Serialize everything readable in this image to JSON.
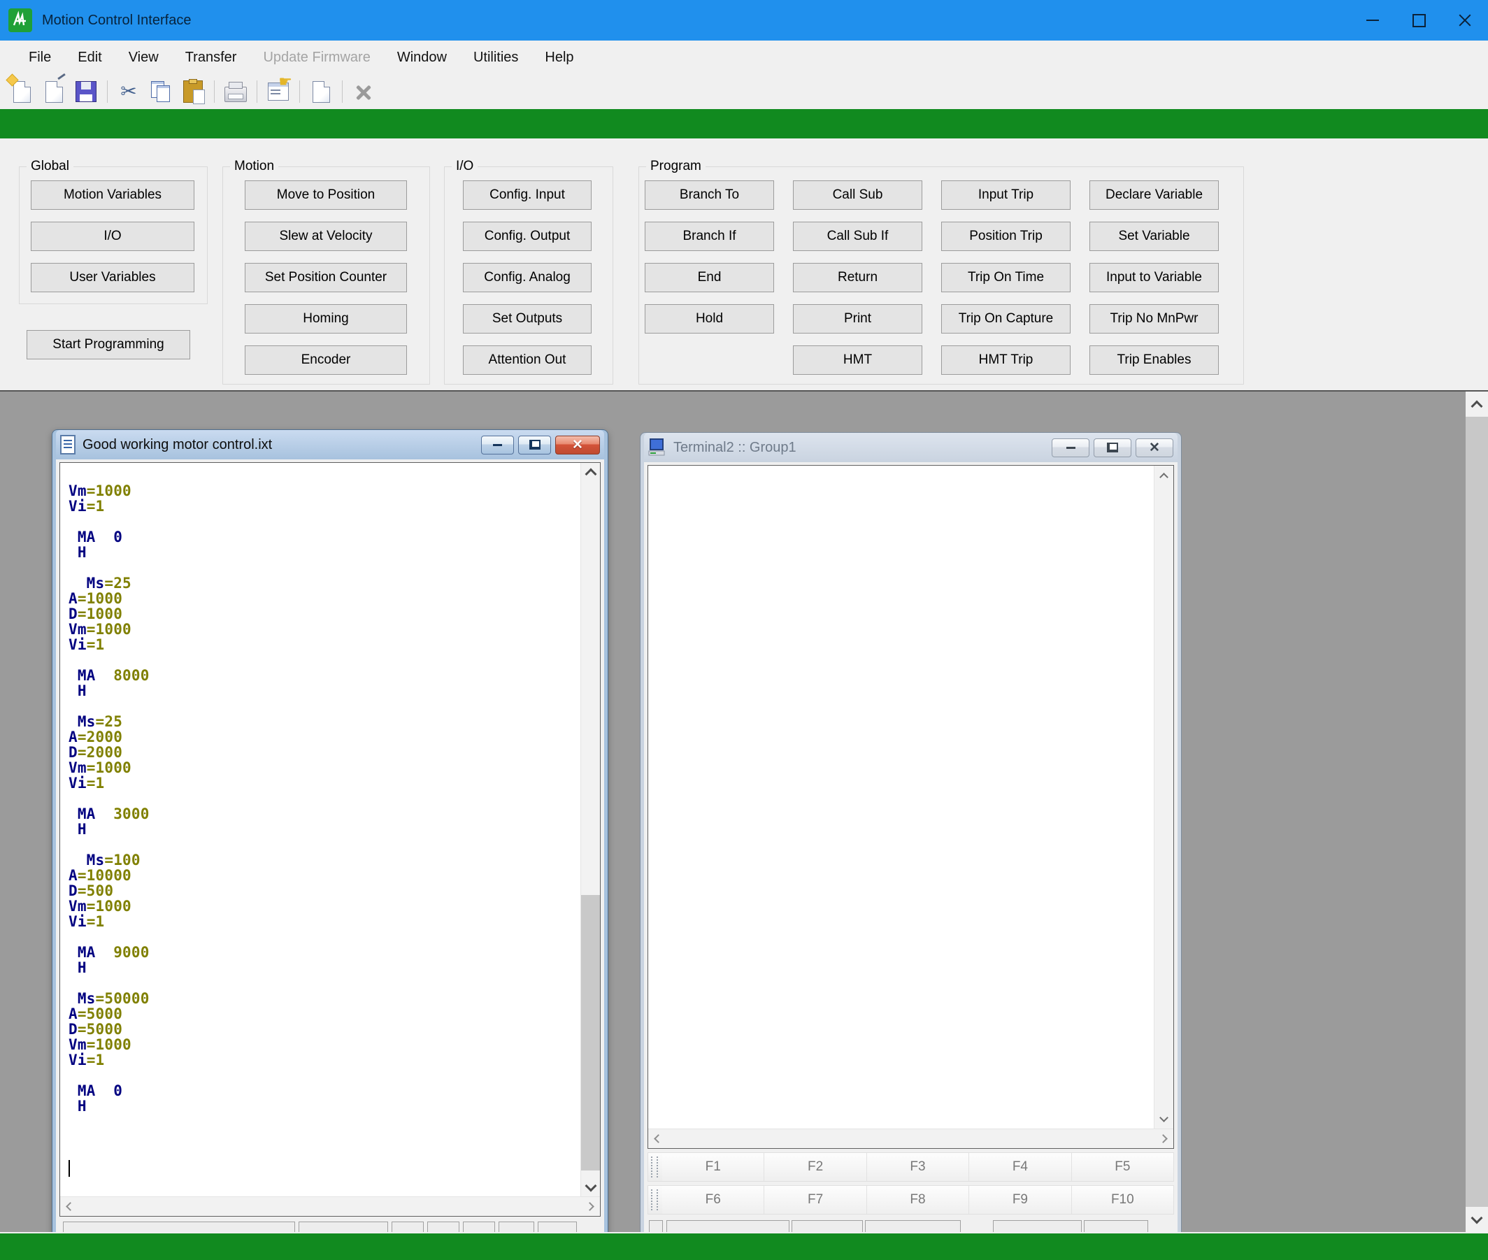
{
  "app": {
    "title": "Motion Control Interface"
  },
  "menu": [
    {
      "label": "File",
      "enabled": true
    },
    {
      "label": "Edit",
      "enabled": true
    },
    {
      "label": "View",
      "enabled": true
    },
    {
      "label": "Transfer",
      "enabled": true
    },
    {
      "label": "Update Firmware",
      "enabled": false
    },
    {
      "label": "Window",
      "enabled": true
    },
    {
      "label": "Utilities",
      "enabled": true
    },
    {
      "label": "Help",
      "enabled": true
    }
  ],
  "toolbar": [
    "new-file",
    "open-file",
    "save",
    "cut",
    "copy",
    "paste",
    "print",
    "properties",
    "new-document",
    "delete"
  ],
  "panels": {
    "global": {
      "label": "Global",
      "buttons": [
        "Motion Variables",
        "I/O",
        "User Variables"
      ]
    },
    "start_button": "Start Programming",
    "motion": {
      "label": "Motion",
      "buttons": [
        "Move to Position",
        "Slew at Velocity",
        "Set Position Counter",
        "Homing",
        "Encoder"
      ]
    },
    "io": {
      "label": "I/O",
      "buttons": [
        "Config. Input",
        "Config. Output",
        "Config. Analog",
        "Set Outputs",
        "Attention Out"
      ]
    },
    "program": {
      "label": "Program",
      "columns": [
        [
          "Branch To",
          "Branch If",
          "End",
          "Hold"
        ],
        [
          "Call Sub",
          "Call Sub If",
          "Return",
          "Print",
          "HMT"
        ],
        [
          "Input Trip",
          "Position Trip",
          "Trip On Time",
          "Trip On Capture",
          "HMT Trip"
        ],
        [
          "Declare Variable",
          "Set Variable",
          "Input to Variable",
          "Trip No MnPwr",
          "Trip Enables"
        ]
      ]
    }
  },
  "editor": {
    "title": "Good working motor control.ixt",
    "lines": [
      [
        [
          "Vm",
          "k"
        ],
        [
          "=1000",
          "n"
        ]
      ],
      [
        [
          "Vi",
          "k"
        ],
        [
          "=1",
          "n"
        ]
      ],
      [],
      [
        [
          " MA  0",
          "k"
        ]
      ],
      [
        [
          " H",
          "k"
        ]
      ],
      [],
      [
        [
          "  Ms",
          "k"
        ],
        [
          "=25",
          "n"
        ]
      ],
      [
        [
          "A",
          "k"
        ],
        [
          "=1000",
          "n"
        ]
      ],
      [
        [
          "D",
          "k"
        ],
        [
          "=1000",
          "n"
        ]
      ],
      [
        [
          "Vm",
          "k"
        ],
        [
          "=1000",
          "n"
        ]
      ],
      [
        [
          "Vi",
          "k"
        ],
        [
          "=1",
          "n"
        ]
      ],
      [],
      [
        [
          " MA  ",
          "k"
        ],
        [
          "8000",
          "n"
        ]
      ],
      [
        [
          " H",
          "k"
        ]
      ],
      [],
      [
        [
          " Ms",
          "k"
        ],
        [
          "=25",
          "n"
        ]
      ],
      [
        [
          "A",
          "k"
        ],
        [
          "=2000",
          "n"
        ]
      ],
      [
        [
          "D",
          "k"
        ],
        [
          "=2000",
          "n"
        ]
      ],
      [
        [
          "Vm",
          "k"
        ],
        [
          "=1000",
          "n"
        ]
      ],
      [
        [
          "Vi",
          "k"
        ],
        [
          "=1",
          "n"
        ]
      ],
      [],
      [
        [
          " MA  ",
          "k"
        ],
        [
          "3000",
          "n"
        ]
      ],
      [
        [
          " H",
          "k"
        ]
      ],
      [],
      [
        [
          "  Ms",
          "k"
        ],
        [
          "=100",
          "n"
        ]
      ],
      [
        [
          "A",
          "k"
        ],
        [
          "=10000",
          "n"
        ]
      ],
      [
        [
          "D",
          "k"
        ],
        [
          "=500",
          "n"
        ]
      ],
      [
        [
          "Vm",
          "k"
        ],
        [
          "=1000",
          "n"
        ]
      ],
      [
        [
          "Vi",
          "k"
        ],
        [
          "=1",
          "n"
        ]
      ],
      [],
      [
        [
          " MA  ",
          "k"
        ],
        [
          "9000",
          "n"
        ]
      ],
      [
        [
          " H",
          "k"
        ]
      ],
      [],
      [
        [
          " Ms",
          "k"
        ],
        [
          "=50000",
          "n"
        ]
      ],
      [
        [
          "A",
          "k"
        ],
        [
          "=5000",
          "n"
        ]
      ],
      [
        [
          "D",
          "k"
        ],
        [
          "=5000",
          "n"
        ]
      ],
      [
        [
          "Vm",
          "k"
        ],
        [
          "=1000",
          "n"
        ]
      ],
      [
        [
          "Vi",
          "k"
        ],
        [
          "=1",
          "n"
        ]
      ],
      [],
      [
        [
          " MA  0",
          "k"
        ]
      ],
      [
        [
          " H",
          "k"
        ]
      ],
      [],
      [],
      []
    ],
    "caret_at_end": true
  },
  "terminal": {
    "title": "Terminal2 :: Group1",
    "fkeys": [
      [
        "F1",
        "F2",
        "F3",
        "F4",
        "F5"
      ],
      [
        "F6",
        "F7",
        "F8",
        "F9",
        "F10"
      ]
    ]
  },
  "colors": {
    "titlebar_blue": "#2090ED",
    "accent_green": "#118A1F",
    "code_keyword": "#000080",
    "code_number": "#808000",
    "mdi_background": "#9b9b9b"
  }
}
